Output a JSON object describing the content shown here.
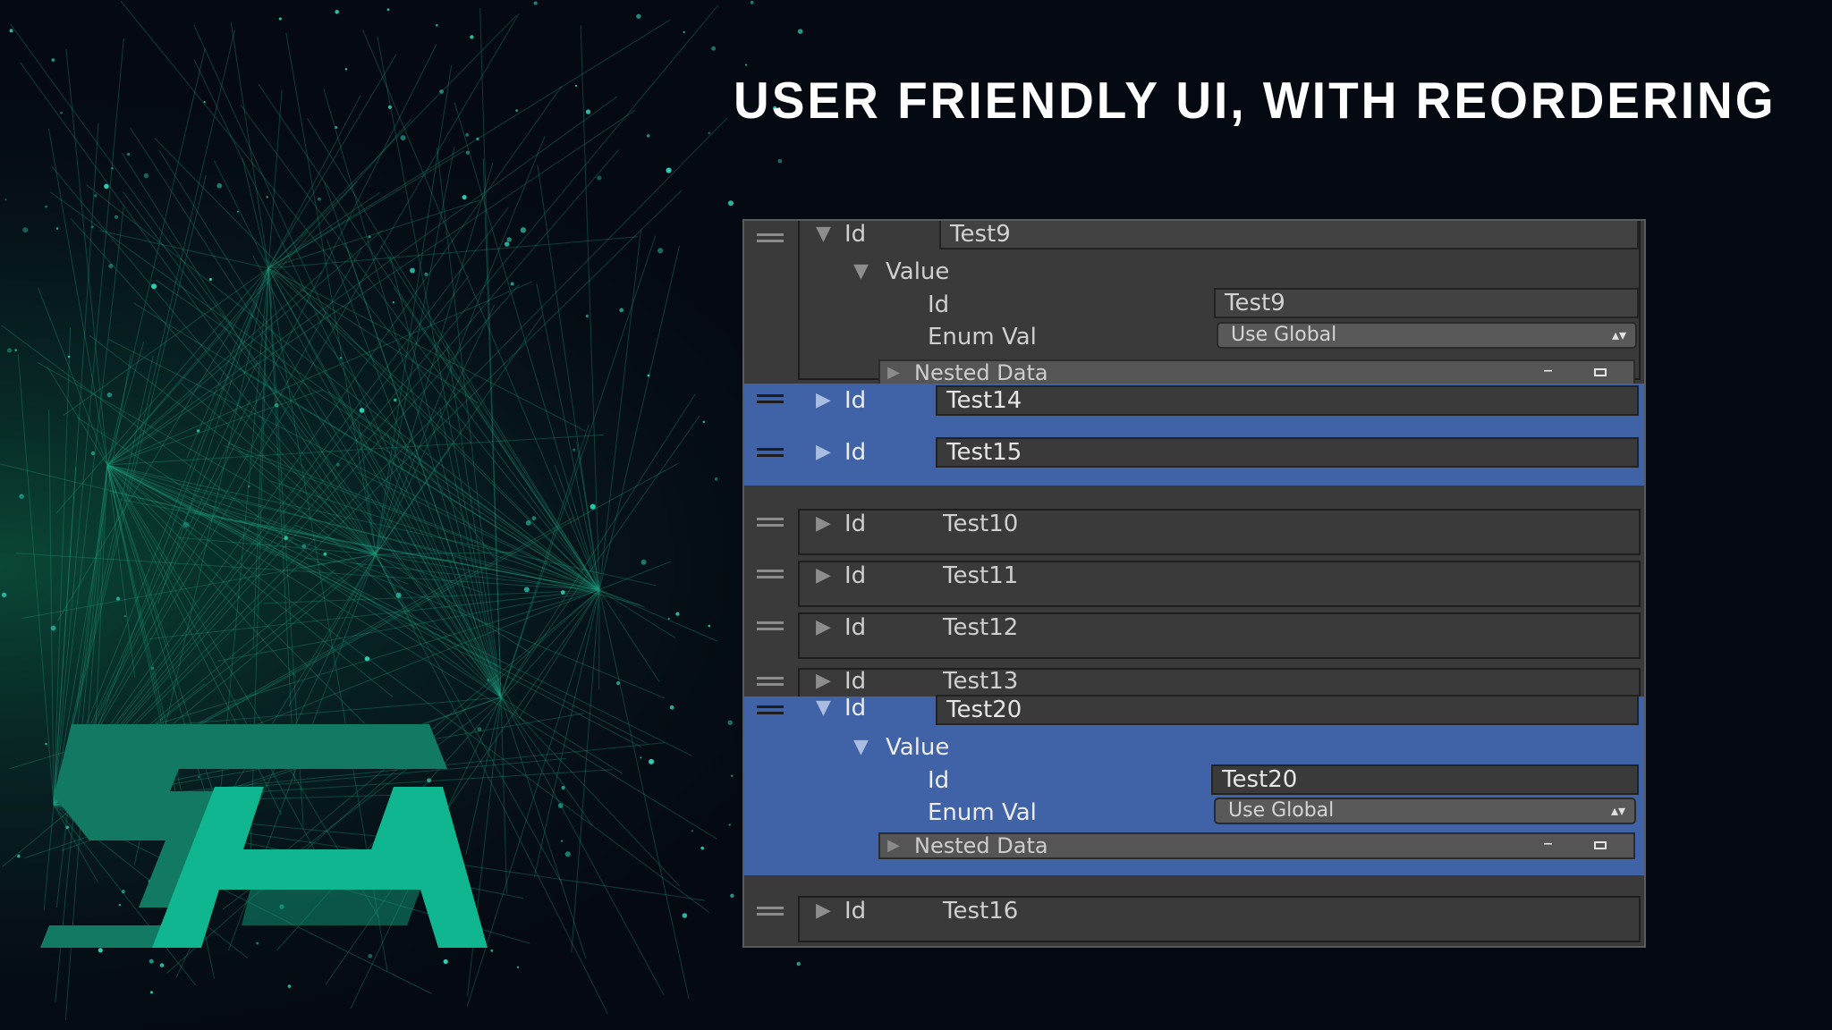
{
  "headline": "USER FRIENDLY UI, WITH REORDERING",
  "colors": {
    "background": "#050a12",
    "network_green": "#1fbf86",
    "selection_blue": "#3f63a6",
    "panel_gray": "#3a3a3a",
    "logo_green": "#10b68f"
  },
  "logo": {
    "name": "RH-logo"
  },
  "inspector": {
    "id_label": "Id",
    "value_label": "Value",
    "enum_label": "Enum Val",
    "nested_label": "Nested Data",
    "enum_option": "Use Global",
    "elements": [
      {
        "id": "Test9",
        "expanded": true,
        "selected": false,
        "value_id": "Test9"
      },
      {
        "id": "Test14",
        "expanded": false,
        "selected": true
      },
      {
        "id": "Test15",
        "expanded": false,
        "selected": true
      },
      {
        "id": "Test10",
        "expanded": false,
        "selected": false
      },
      {
        "id": "Test11",
        "expanded": false,
        "selected": false
      },
      {
        "id": "Test12",
        "expanded": false,
        "selected": false
      },
      {
        "id": "Test13",
        "expanded": false,
        "selected": false
      },
      {
        "id": "Test20",
        "expanded": true,
        "selected": true,
        "value_id": "Test20"
      },
      {
        "id": "Test16",
        "expanded": false,
        "selected": false
      }
    ]
  }
}
